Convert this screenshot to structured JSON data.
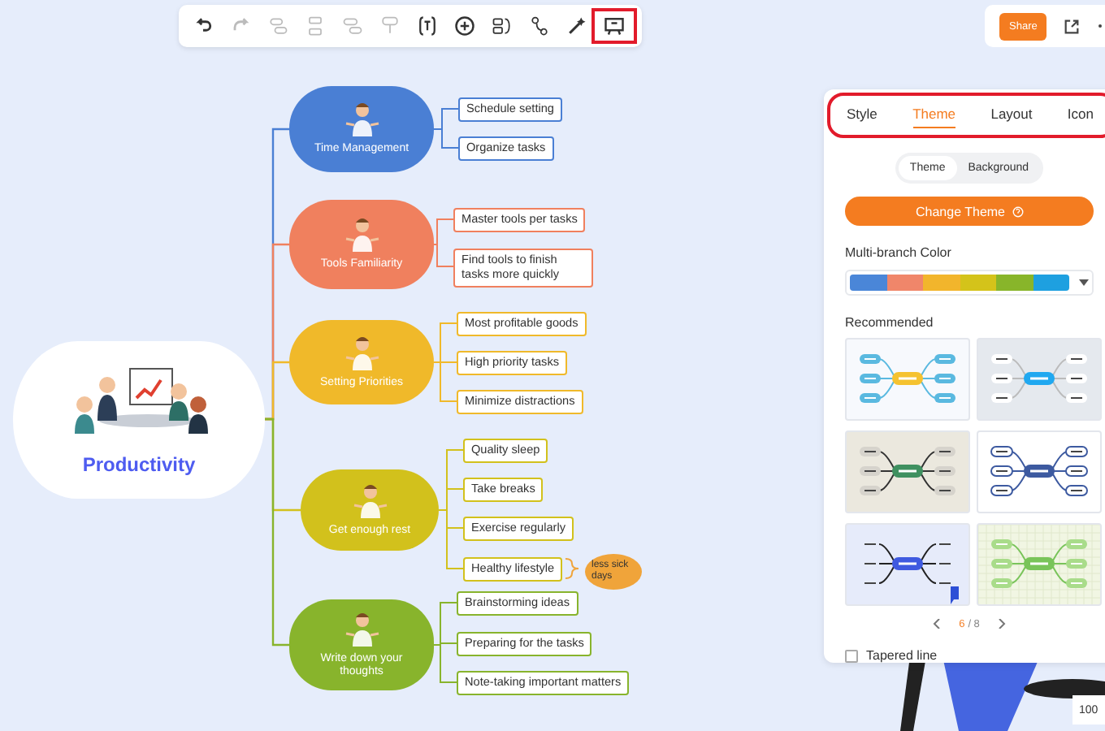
{
  "toolbar": {
    "tools": [
      {
        "kind": "undo",
        "disabled": false,
        "highlighted": false
      },
      {
        "kind": "redo",
        "disabled": true,
        "highlighted": false
      },
      {
        "kind": "topic",
        "disabled": true,
        "highlighted": false
      },
      {
        "kind": "subtopic",
        "disabled": true,
        "highlighted": false
      },
      {
        "kind": "floating",
        "disabled": true,
        "highlighted": false
      },
      {
        "kind": "callout",
        "disabled": true,
        "highlighted": false
      },
      {
        "kind": "text",
        "disabled": false,
        "highlighted": false
      },
      {
        "kind": "add",
        "disabled": false,
        "highlighted": false
      },
      {
        "kind": "summary",
        "disabled": false,
        "highlighted": false
      },
      {
        "kind": "relation",
        "disabled": false,
        "highlighted": false
      },
      {
        "kind": "wand",
        "disabled": false,
        "highlighted": false
      },
      {
        "kind": "present",
        "disabled": false,
        "highlighted": true
      }
    ]
  },
  "header": {
    "share": "Share"
  },
  "panel": {
    "highlighted": true,
    "tabs": [
      {
        "label": "Style",
        "selected": false
      },
      {
        "label": "Theme",
        "selected": true
      },
      {
        "label": "Layout",
        "selected": false
      },
      {
        "label": "Icon",
        "selected": false
      }
    ],
    "segments": [
      {
        "label": "Theme",
        "selected": true
      },
      {
        "label": "Background",
        "selected": false
      }
    ],
    "change_theme": "Change Theme",
    "branch_color": {
      "label": "Multi-branch Color",
      "colors": [
        {
          "color": "#4a86d8"
        },
        {
          "color": "#f0866a"
        },
        {
          "color": "#f2b52c"
        },
        {
          "color": "#d4c31a"
        },
        {
          "color": "#88b52a"
        },
        {
          "color": "#1ea0e0"
        }
      ]
    },
    "recommended": {
      "label": "Recommended",
      "themes": [
        {
          "kind": "plain",
          "color": "#f5c230"
        },
        {
          "kind": "grey",
          "color": "#20a8f0"
        },
        {
          "kind": "paper",
          "color": "#3f9060"
        },
        {
          "kind": "frame",
          "color": "#3d5aa0"
        },
        {
          "kind": "figure",
          "color": "#3f5ae0"
        },
        {
          "kind": "grid",
          "color": "#79c45a"
        }
      ]
    },
    "pager": {
      "current": "6",
      "total": "/ 8"
    },
    "tapered": {
      "label": "Tapered line",
      "checked": false
    }
  },
  "zoom": "100",
  "mindmap": {
    "root": "Productivity",
    "branches": [
      {
        "label": "Time Management",
        "color": "#4a7fd4",
        "leaves": [
          {
            "label": "Schedule setting"
          },
          {
            "label": "Organize tasks"
          }
        ]
      },
      {
        "label": "Tools Familiarity",
        "color": "#f0805e",
        "leaves": [
          {
            "label": "Master tools per tasks"
          },
          {
            "label": "Find tools to finish tasks more quickly"
          }
        ]
      },
      {
        "label": "Setting Priorities",
        "color": "#f0b92a",
        "leaves": [
          {
            "label": "Most profitable goods"
          },
          {
            "label": "High priority tasks"
          },
          {
            "label": "Minimize distractions"
          }
        ]
      },
      {
        "label": "Get enough rest",
        "color": "#d2c11c",
        "leaves": [
          {
            "label": "Quality sleep"
          },
          {
            "label": "Take breaks"
          },
          {
            "label": "Exercise regularly"
          },
          {
            "label": "Healthy lifestyle",
            "note": "less sick days"
          }
        ]
      },
      {
        "label": "Write down your thoughts",
        "color": "#88b42c",
        "leaves": [
          {
            "label": "Brainstorming ideas"
          },
          {
            "label": "Preparing for the tasks"
          },
          {
            "label": "Note-taking important matters"
          }
        ]
      }
    ]
  }
}
